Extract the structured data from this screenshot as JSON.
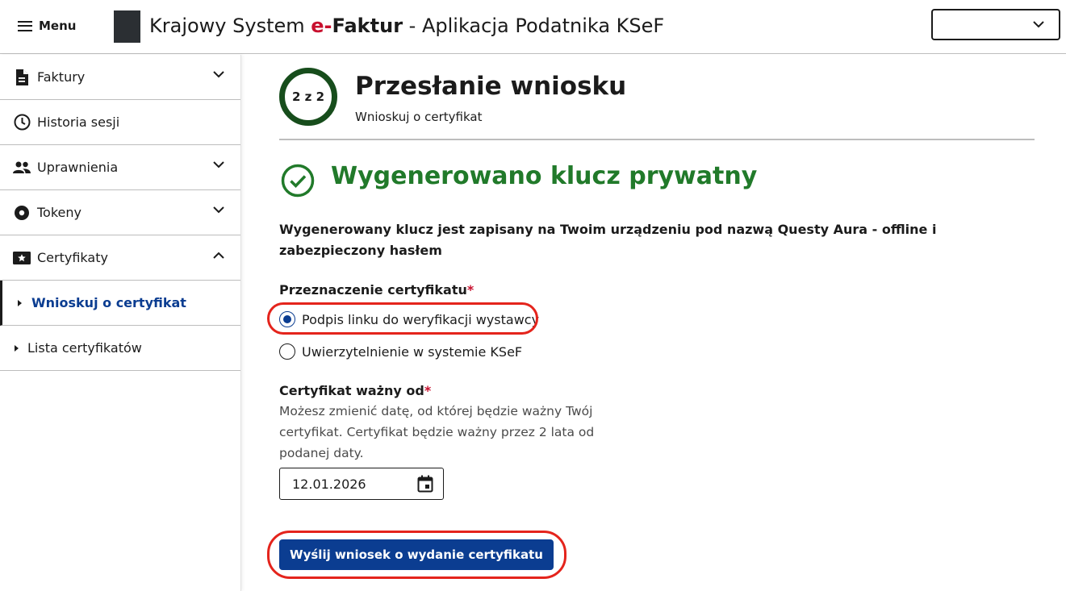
{
  "header": {
    "menu_label": "Menu",
    "title_prefix": "Krajowy System ",
    "title_brand_e": "e-",
    "title_brand_rest": "Faktur",
    "title_suffix": " - Aplikacja Podatnika KSeF",
    "select_value": ""
  },
  "sidebar": {
    "items": [
      {
        "label": "Faktury",
        "icon": "document-icon",
        "expandable": true,
        "expanded": false
      },
      {
        "label": "Historia sesji",
        "icon": "clock-icon",
        "expandable": false
      },
      {
        "label": "Uprawnienia",
        "icon": "people-icon",
        "expandable": true,
        "expanded": false
      },
      {
        "label": "Tokeny",
        "icon": "disc-icon",
        "expandable": true,
        "expanded": false
      },
      {
        "label": "Certyfikaty",
        "icon": "certificate-icon",
        "expandable": true,
        "expanded": true
      }
    ],
    "subitems": [
      {
        "label": "Wnioskuj o certyfikat",
        "active": true
      },
      {
        "label": "Lista certyfikatów",
        "active": false
      }
    ]
  },
  "main": {
    "step": "2 z 2",
    "title": "Przesłanie wniosku",
    "subtitle": "Wnioskuj o certyfikat",
    "success_title": "Wygenerowano klucz prywatny",
    "info_text": "Wygenerowany klucz jest zapisany na Twoim urządzeniu pod nazwą Questy Aura - offline i zabezpieczony hasłem",
    "purpose_label": "Przeznaczenie certyfikatu",
    "required_mark": "*",
    "purpose_options": [
      {
        "label": "Podpis linku do weryfikacji wystawcy",
        "selected": true
      },
      {
        "label": "Uwierzytelnienie w systemie KSeF",
        "selected": false
      }
    ],
    "valid_from_label": "Certyfikat ważny od",
    "valid_from_hint": "Możesz zmienić datę, od której będzie ważny Twój certyfikat. Certyfikat będzie ważny przez 2 lata od podanej daty.",
    "valid_from_value": "12.01.2026",
    "submit_label": "Wyślij wniosek o wydanie certyfikatu"
  },
  "colors": {
    "primary": "#0b3d91",
    "success": "#217a2a",
    "step_ring": "#174d1c",
    "required": "#c8102e",
    "highlight": "#e4241c"
  }
}
